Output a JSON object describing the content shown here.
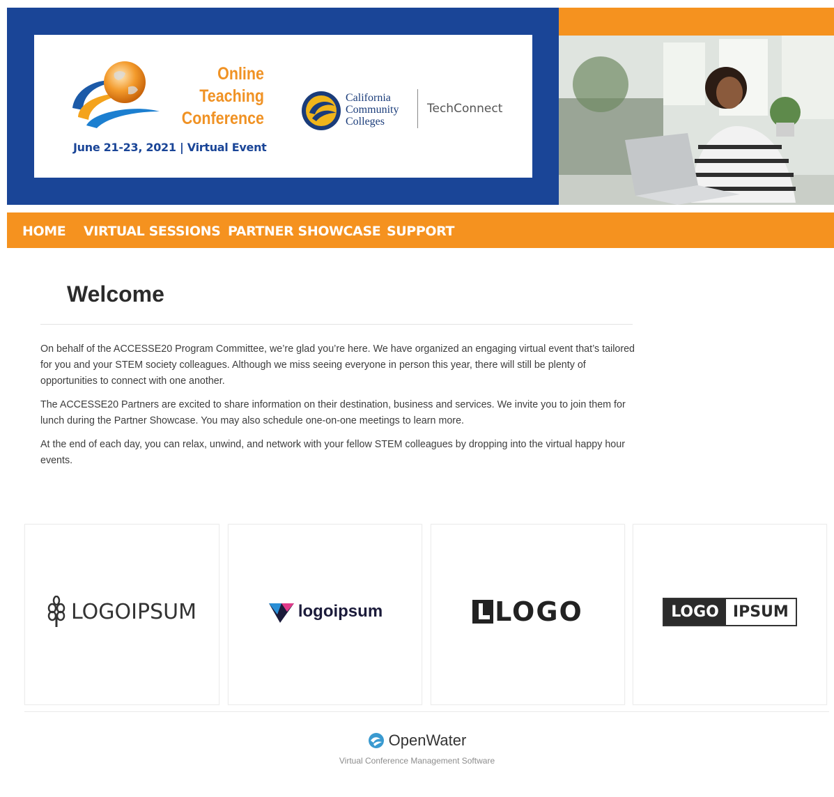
{
  "header": {
    "conference_title_lines": [
      "Online",
      "Teaching",
      "Conference"
    ],
    "conference_date": "June 21-23, 2021 | Virtual Event",
    "partner_name_lines": [
      "California",
      "Community",
      "Colleges"
    ],
    "partner_product": "TechConnect"
  },
  "nav": {
    "items": [
      {
        "label": "HOME"
      },
      {
        "label": "VIRTUAL SESSIONS"
      },
      {
        "label": "PARTNER SHOWCASE"
      },
      {
        "label": "SUPPORT"
      }
    ]
  },
  "welcome": {
    "title": "Welcome",
    "paragraphs": [
      "On behalf of the ACCESSE20 Program Committee, we’re glad you’re here. We have organized an engaging virtual event that’s tailored for you and your STEM society colleagues. Although we miss seeing everyone in person this year, there will still be plenty of opportunities to connect with one another.",
      "The ACCESSE20 Partners are excited to share information on their destination, business and services. We invite you to join them for lunch during the Partner Showcase. You may also schedule one-on-one meetings to learn more.",
      "At the end of each day, you can relax, unwind, and network with your fellow STEM colleagues by dropping into the virtual happy hour events."
    ]
  },
  "sponsors": [
    {
      "text": "LOGOIPSUM",
      "icon": "wheat-icon"
    },
    {
      "text": "logoipsum",
      "icon": "triangle-drop-icon"
    },
    {
      "text": "LOGO",
      "icon": "block-l-icon"
    },
    {
      "text_left": "LOGO",
      "text_right": "IPSUM"
    }
  ],
  "footer": {
    "brand": "OpenWater",
    "tagline": "Virtual Conference Management Software"
  },
  "colors": {
    "navy": "#1a4597",
    "orange": "#f5921f"
  }
}
